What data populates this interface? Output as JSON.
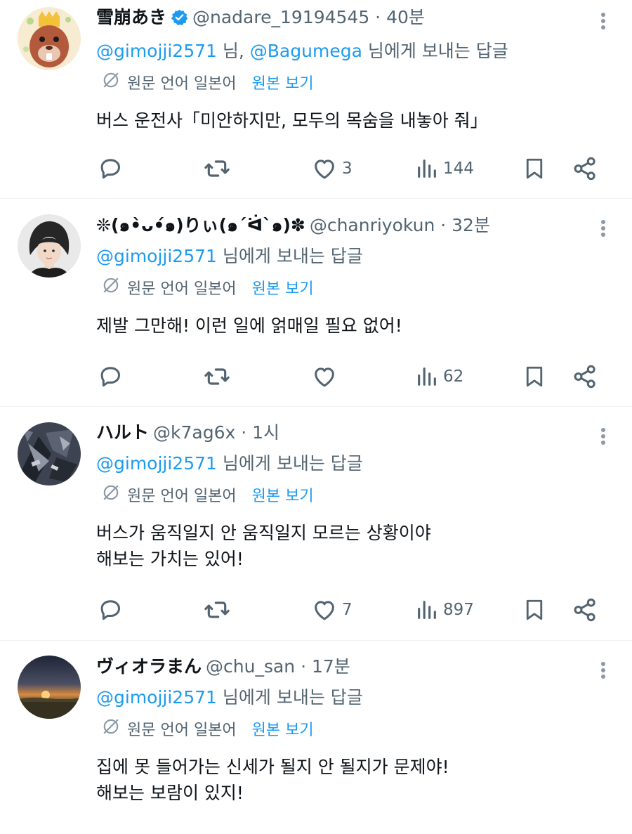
{
  "common": {
    "translate_label": "원문 언어 일본어",
    "view_original": "원본 보기",
    "replying_suffix": " 님에게 보내는 답글"
  },
  "tweets": [
    {
      "name": "雪崩あき",
      "verified": true,
      "handle": "@nadare_19194545",
      "time": "40분",
      "mentions": [
        "@gimojji2571",
        "@Bagumega"
      ],
      "mention_separator": " 님, ",
      "text_lines": [
        "버스 운전사「미안하지만, 모두의 목숨을 내놓아 줘」"
      ],
      "stats": {
        "replies": "",
        "retweets": "",
        "likes": "3",
        "views": "144"
      }
    },
    {
      "name": "❊(๑•̀ᴗ•́๑)りぃ(๑´ᐛ`๑)✽",
      "verified": false,
      "handle": "@chanriyokun",
      "time": "32분",
      "mentions": [
        "@gimojji2571"
      ],
      "text_lines": [
        "제발 그만해! 이런 일에 얽매일 필요 없어!"
      ],
      "stats": {
        "replies": "",
        "retweets": "",
        "likes": "",
        "views": "62"
      }
    },
    {
      "name": "ハルト",
      "verified": false,
      "handle": "@k7ag6x",
      "time": "1시",
      "mentions": [
        "@gimojji2571"
      ],
      "text_lines": [
        "버스가 움직일지 안 움직일지 모르는 상황이야",
        "해보는 가치는 있어!"
      ],
      "stats": {
        "replies": "",
        "retweets": "",
        "likes": "7",
        "views": "897"
      }
    },
    {
      "name": "ヴィオラまん",
      "verified": false,
      "handle": "@chu_san",
      "time": "17분",
      "mentions": [
        "@gimojji2571"
      ],
      "text_lines": [
        "집에 못 들어가는 신세가 될지 안 될지가 문제야!",
        "해보는 보람이 있지!"
      ],
      "stats": {
        "replies": "",
        "retweets": "",
        "likes": "",
        "views": ""
      }
    }
  ],
  "icons": {
    "reply": "reply-icon",
    "retweet": "retweet-icon",
    "like": "heart-icon",
    "views": "views-icon",
    "bookmark": "bookmark-icon",
    "share": "share-icon",
    "more": "more-options-icon",
    "translate": "translate-globe-icon",
    "verified": "verified-badge-icon"
  },
  "colors": {
    "link": "#1d9bf0",
    "secondary_text": "#536471",
    "primary_text": "#0f1419",
    "divider": "#eff3f4",
    "icon": "#536471"
  }
}
